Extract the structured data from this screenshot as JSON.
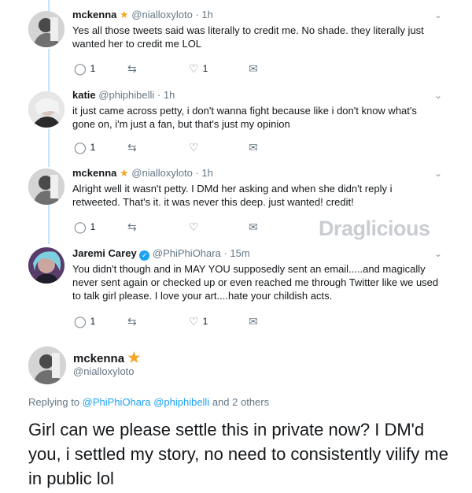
{
  "tweets": [
    {
      "name": "mckenna",
      "handle": "@nialloxyloto",
      "time": "1h",
      "text": "Yes all those tweets said was literally to credit me. No shade. they literally just wanted her to credit me LOL",
      "reply_count": "1",
      "like_count": "1"
    },
    {
      "name": "katie",
      "handle": "@phiphibelli",
      "time": "1h",
      "text": "it just came across petty, i don't wanna fight because like i don't know what's gone on, i'm just a fan, but that's just my opinion",
      "reply_count": "1",
      "like_count": ""
    },
    {
      "name": "mckenna",
      "handle": "@nialloxyloto",
      "time": "1h",
      "text": "Alright well it wasn't petty. I DMd her asking and when she didn't reply i retweeted. That's it. it was never this deep. just wanted! credit!",
      "reply_count": "1",
      "like_count": ""
    },
    {
      "name": "Jaremi Carey",
      "handle": "@PhiPhiOhara",
      "time": "15m",
      "text": "You didn't though and in MAY YOU supposedly sent an email.....and magically never sent again or checked up or even reached me through Twitter like we used to talk girl please. I love your art....hate your childish acts.",
      "reply_count": "1",
      "like_count": "1"
    }
  ],
  "main": {
    "name": "mckenna",
    "handle": "@nialloxyloto",
    "replying_prefix": "Replying to",
    "replying_links": "@PhiPhiOhara @phiphibelli",
    "replying_suffix": "and 2 others",
    "text": "Girl can we please settle this in private now? I DM'd you, i settled my story, no need to consistently vilify me in public lol"
  },
  "watermark": "Draglicious",
  "icons": {
    "reply": "reply-icon",
    "retweet": "retweet-icon",
    "like": "heart-icon",
    "dm": "envelope-icon",
    "star": "star-icon",
    "verified": "verified-badge-icon",
    "more": "chevron-down-icon"
  },
  "colors": {
    "star": "#f5a623",
    "link": "#1da1f2",
    "thread": "#c6e3f7",
    "muted": "#657786"
  }
}
